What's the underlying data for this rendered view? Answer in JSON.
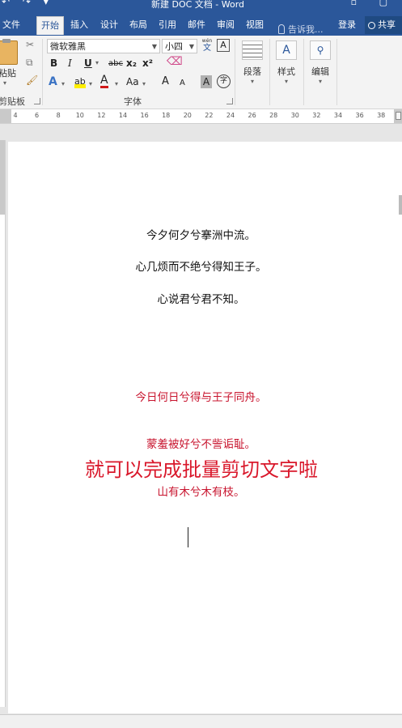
{
  "window": {
    "title": "新建 DOC 文档 - Word",
    "quick_access": "↶ ↷ ▾"
  },
  "tabs": {
    "file": "文件",
    "home": "开始",
    "insert": "插入",
    "design": "设计",
    "layout": "布局",
    "references": "引用",
    "mailings": "邮件",
    "review": "审阅",
    "view": "视图",
    "tell_me": "告诉我...",
    "login": "登录",
    "share": "共享"
  },
  "ribbon": {
    "clipboard": {
      "paste": "粘贴",
      "group_label": "剪贴板"
    },
    "font": {
      "font_name": "微软雅黑",
      "font_size": "小四",
      "wen_label": "文",
      "wen_top": "wén",
      "group_label": "字体",
      "bold": "B",
      "italic": "I",
      "underline": "U",
      "strike": "abc",
      "subscript": "x₂",
      "superscript": "x²",
      "text_effects": "A",
      "highlight": "ab",
      "font_color": "A",
      "change_case": "Aa",
      "grow": "A",
      "shrink": "A",
      "shading": "A",
      "enclose": "字",
      "border_char": "A"
    },
    "paragraph": {
      "label": "段落"
    },
    "styles": {
      "label": "样式"
    },
    "editing": {
      "label": "编辑"
    }
  },
  "ruler": {
    "ticks": [
      "4",
      "6",
      "8",
      "10",
      "12",
      "14",
      "16",
      "18",
      "20",
      "22",
      "24",
      "26",
      "28",
      "30",
      "32",
      "34",
      "36",
      "38"
    ]
  },
  "document": {
    "lines": [
      "今夕何夕兮搴洲中流。",
      "心几烦而不绝兮得知王子。",
      "心说君兮君不知。",
      "今日何日兮得与王子同舟。",
      "蒙羞被好兮不訾诟耻。",
      "山有木兮木有枝。"
    ],
    "overlay_text": "就可以完成批量剪切文字啦"
  },
  "colors": {
    "accent": "#2b579a",
    "red_text": "#c8142e",
    "overlay_red": "#d9182b"
  }
}
